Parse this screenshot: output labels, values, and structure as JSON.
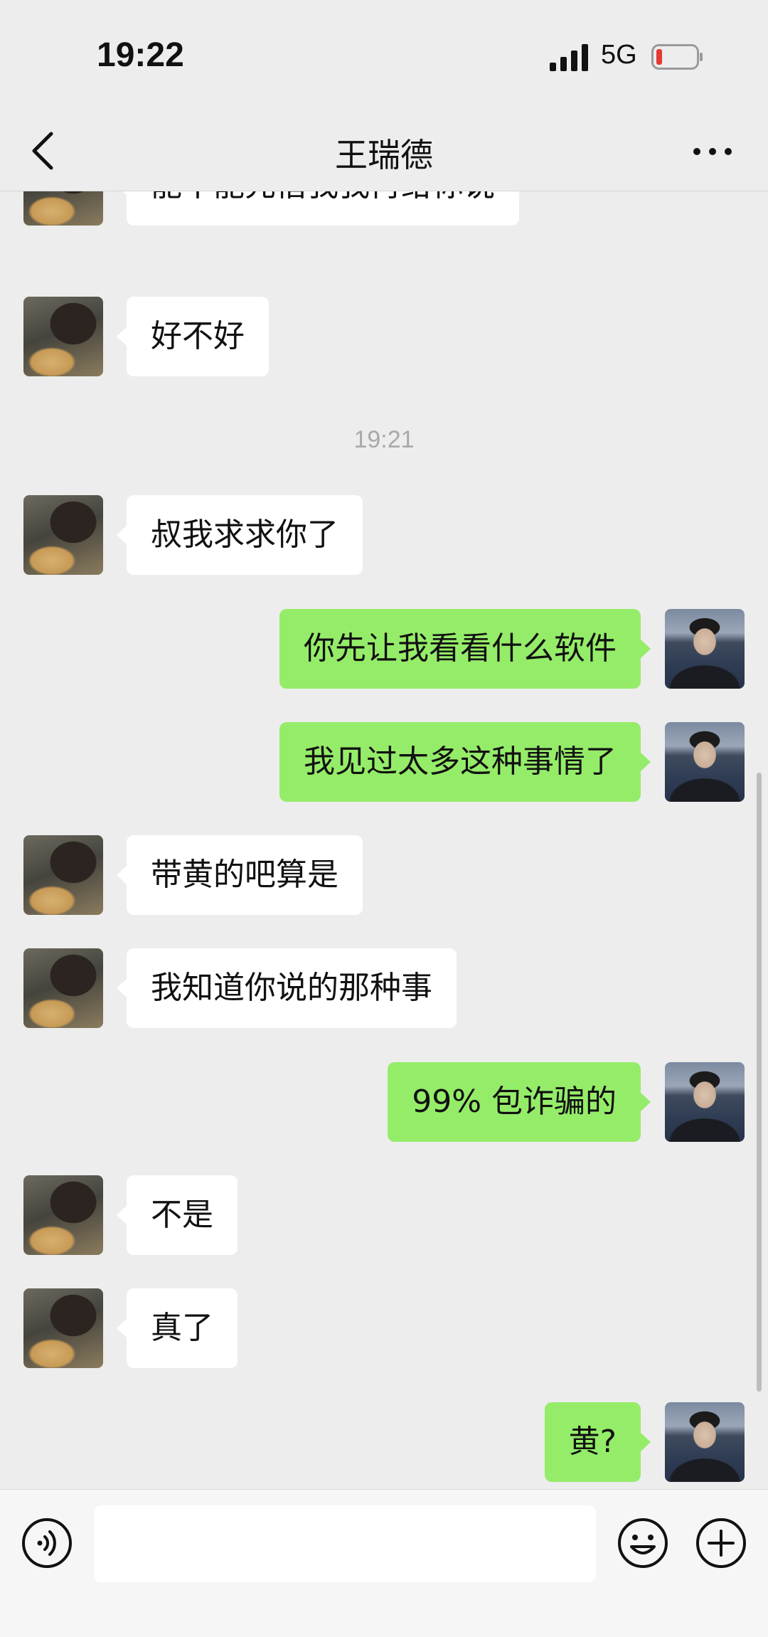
{
  "status_bar": {
    "time": "19:22",
    "network": "5G",
    "battery_color": "#e53935"
  },
  "nav": {
    "title": "王瑞德"
  },
  "chat": {
    "time_divider": "19:21",
    "messages": [
      {
        "side": "in",
        "text": "能不能先借我我再给你说"
      },
      {
        "side": "in",
        "text": "好不好"
      },
      {
        "side": "in",
        "text": "叔我求求你了"
      },
      {
        "side": "out",
        "text": "你先让我看看什么软件"
      },
      {
        "side": "out",
        "text": "我见过太多这种事情了"
      },
      {
        "side": "in",
        "text": "带黄的吧算是"
      },
      {
        "side": "in",
        "text": "我知道你说的那种事"
      },
      {
        "side": "out",
        "text": "99% 包诈骗的"
      },
      {
        "side": "in",
        "text": "不是"
      },
      {
        "side": "in",
        "text": "真了"
      },
      {
        "side": "out",
        "text": "黄?"
      }
    ]
  },
  "input_bar": {
    "value": "",
    "placeholder": ""
  },
  "colors": {
    "background": "#ededed",
    "incoming_bubble": "#ffffff",
    "outgoing_bubble": "#95ec69"
  },
  "icons": {
    "back": "chevron-left-icon",
    "more": "more-icon",
    "voice": "voice-icon",
    "emoji": "emoji-icon",
    "plus": "plus-icon"
  }
}
